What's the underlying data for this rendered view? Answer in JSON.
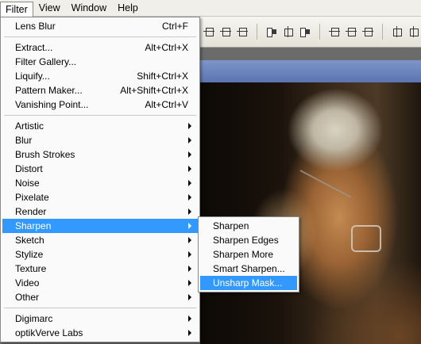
{
  "menubar": {
    "items": [
      {
        "label": "Filter"
      },
      {
        "label": "View"
      },
      {
        "label": "Window"
      },
      {
        "label": "Help"
      }
    ]
  },
  "filter_menu": {
    "top": [
      {
        "label": "Lens Blur",
        "shortcut": "Ctrl+F"
      }
    ],
    "group2": [
      {
        "label": "Extract...",
        "shortcut": "Alt+Ctrl+X"
      },
      {
        "label": "Filter Gallery...",
        "shortcut": ""
      },
      {
        "label": "Liquify...",
        "shortcut": "Shift+Ctrl+X"
      },
      {
        "label": "Pattern Maker...",
        "shortcut": "Alt+Shift+Ctrl+X"
      },
      {
        "label": "Vanishing Point...",
        "shortcut": "Alt+Ctrl+V"
      }
    ],
    "group3": [
      {
        "label": "Artistic"
      },
      {
        "label": "Blur"
      },
      {
        "label": "Brush Strokes"
      },
      {
        "label": "Distort"
      },
      {
        "label": "Noise"
      },
      {
        "label": "Pixelate"
      },
      {
        "label": "Render"
      },
      {
        "label": "Sharpen"
      },
      {
        "label": "Sketch"
      },
      {
        "label": "Stylize"
      },
      {
        "label": "Texture"
      },
      {
        "label": "Video"
      },
      {
        "label": "Other"
      }
    ],
    "group4": [
      {
        "label": "Digimarc"
      },
      {
        "label": "optikVerve Labs"
      }
    ],
    "highlighted": "Sharpen"
  },
  "sharpen_submenu": {
    "items": [
      {
        "label": "Sharpen"
      },
      {
        "label": "Sharpen Edges"
      },
      {
        "label": "Sharpen More"
      },
      {
        "label": "Smart Sharpen..."
      },
      {
        "label": "Unsharp Mask..."
      }
    ],
    "highlighted": "Unsharp Mask..."
  },
  "colors": {
    "highlight": "#3399ff",
    "menu_bg": "#fafafa",
    "title_bar": "#6a83bd"
  },
  "icons": [
    "align-left-icon",
    "align-center-icon",
    "align-right-icon",
    "align-top-icon",
    "align-middle-icon",
    "align-bottom-icon",
    "distribute-icon",
    "submenu-arrow-icon"
  ]
}
